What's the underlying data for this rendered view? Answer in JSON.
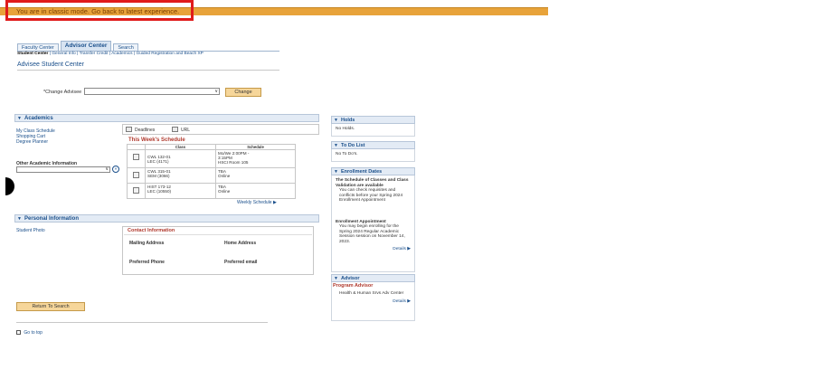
{
  "classic_mode": {
    "message": "You are in classic mode. Go back to latest experience."
  },
  "tabs": [
    {
      "label": "Faculty Center"
    },
    {
      "label": "Advisor Center"
    },
    {
      "label": "Search"
    }
  ],
  "subnav": {
    "items": [
      "Student Center",
      "General Info",
      "Transfer Credit",
      "Academics",
      "Guided Registration and Beach XP"
    ],
    "separator": "|"
  },
  "page_title": "Advisee Student Center",
  "change_advisee": {
    "label": "*Change Advisee",
    "selected_value": "",
    "button_label": "Change"
  },
  "academics": {
    "header": "Academics",
    "links": [
      "My Class Schedule",
      "Shopping Cart",
      "Degree Planner"
    ],
    "other_label": "Other Academic Information",
    "toolbar": {
      "deadlines": "Deadlines",
      "url": "URL"
    },
    "schedule": {
      "title": "This Week's Schedule",
      "columns": [
        "Class",
        "Schedule"
      ],
      "rows": [
        {
          "class_line1": "CWL 132-01",
          "class_line2": "LEC (4171)",
          "sched_line1": "Mo/We 2:00PM -",
          "sched_line2": "3:15PM",
          "sched_line3": "HSCI Room 105"
        },
        {
          "class_line1": "CWL 315-01",
          "class_line2": "SEM (3066)",
          "sched_line1": "TBA",
          "sched_line2": "Online",
          "sched_line3": ""
        },
        {
          "class_line1": "HIST 173-12",
          "class_line2": "LEC (10550)",
          "sched_line1": "TBA",
          "sched_line2": "Online",
          "sched_line3": ""
        }
      ],
      "weekly_link": "Weekly Schedule"
    }
  },
  "personal": {
    "header": "Personal Information",
    "student_photo": "Student Photo",
    "contact_title": "Contact Information",
    "mailing_address": "Mailing Address",
    "home_address": "Home Address",
    "preferred_phone": "Preferred Phone",
    "preferred_email": "Preferred email"
  },
  "holds": {
    "header": "Holds",
    "body": "No Holds."
  },
  "todo": {
    "header": "To Do List",
    "body": "No To Do's."
  },
  "enrollment_dates": {
    "header": "Enrollment Dates",
    "bold_line": "The Schedule of Classes and Class Validation are available",
    "text": "You can check requisites and conflicts before your Spring 2024 Enrollment Appointment",
    "appointment_title": "Enrollment Appointment",
    "appointment_text": "You may begin enrolling for the Spring 2024 Regular Academic Session session on November 14, 2023.",
    "details": "Details"
  },
  "advisor": {
    "header": "Advisor",
    "program_advisor": "Program Advisor",
    "center": "Health & Human Srvs Adv Center",
    "details": "Details"
  },
  "footer": {
    "return_button": "Return To Search",
    "go_to_top": "Go to top"
  }
}
